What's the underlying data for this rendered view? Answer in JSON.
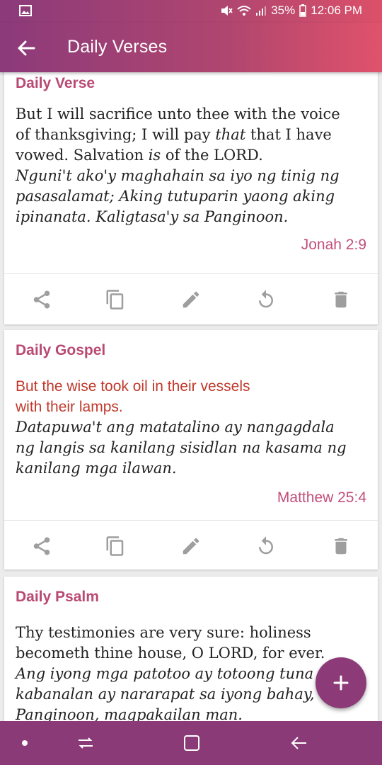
{
  "status_bar": {
    "battery": "35%",
    "time": "12:06 PM"
  },
  "app_bar": {
    "title": "Daily Verses"
  },
  "cards": [
    {
      "heading": "Daily Verse",
      "english_1": "But I will sacrifice unto thee with the voice",
      "english_2a": "of thanksgiving; I will pay ",
      "english_2b": "that",
      "english_2c": " that I have",
      "english_3a": "vowed. Salvation ",
      "english_3b": "is",
      "english_3c": " of the LORD.",
      "translation_1": "Nguni't ako'y maghahain sa iyo ng tinig ng",
      "translation_2": "pasasalamat; Aking tutuparin yaong aking",
      "translation_3": "ipinanata. Kaligtasa'y sa Panginoon.",
      "reference": "Jonah 2:9"
    },
    {
      "heading": "Daily Gospel",
      "english_1": "But the wise took oil in their vessels",
      "english_2": "with their lamps.",
      "translation_1": "Datapuwa't ang matatalino ay nangagdala",
      "translation_2": "ng langis sa kanilang sisidlan na kasama ng",
      "translation_3": "kanilang mga ilawan.",
      "reference": "Matthew 25:4"
    },
    {
      "heading": "Daily Psalm",
      "english_1": "Thy testimonies are very sure: holiness",
      "english_2": "becometh thine house, O LORD, for ever.",
      "translation_1": "Ang iyong mga patotoo ay totoong tuna",
      "translation_2": "kabanalan ay nararapat sa iyong bahay,",
      "translation_3": "Panginoon, magpakailan man."
    }
  ],
  "colors": {
    "accent": "#b94a72",
    "gospel_text": "#c0392b",
    "fab": "#8c3a78"
  },
  "icons": [
    "back-arrow-icon",
    "share-icon",
    "copy-icon",
    "edit-icon",
    "refresh-icon",
    "delete-icon",
    "add-icon"
  ]
}
